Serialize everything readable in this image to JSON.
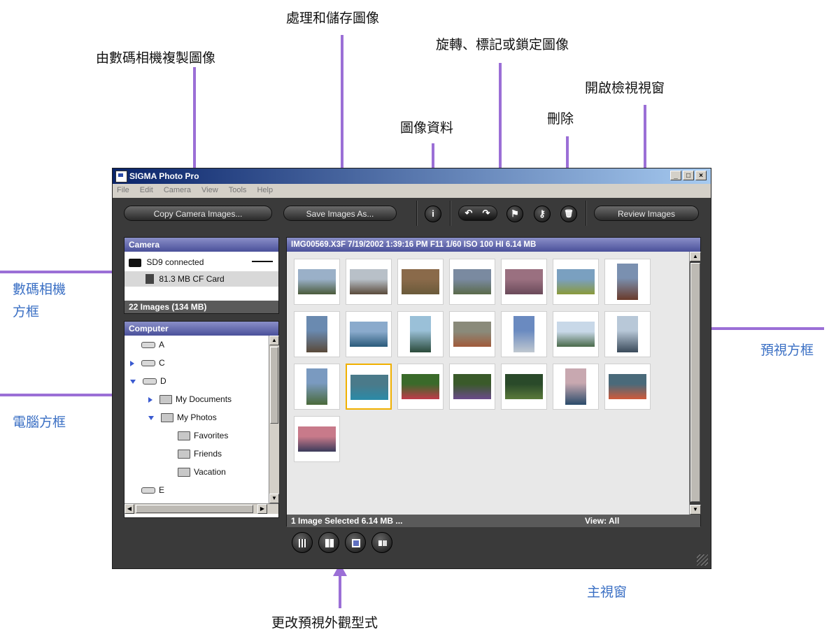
{
  "annotations": {
    "copy_from_camera": "由數碼相機複製圖像",
    "process_save": "處理和儲存圖像",
    "rotate_mark_lock": "旋轉、標記或鎖定圖像",
    "open_review": "開啟檢視視窗",
    "delete": "刪除",
    "image_info": "圖像資料",
    "camera_pane_line1": "數碼相機",
    "camera_pane_line2": "方框",
    "computer_pane": "電腦方框",
    "preview_pane": "預視方框",
    "main_window": "主視窗",
    "change_preview_style": "更改預視外觀型式"
  },
  "window": {
    "title": "SIGMA Photo Pro",
    "controls": [
      "_",
      "□",
      "×"
    ]
  },
  "menu": [
    "File",
    "Edit",
    "Camera",
    "View",
    "Tools",
    "Help"
  ],
  "toolbar": {
    "copy_label": "Copy Camera Images...",
    "save_label": "Save Images As...",
    "review_label": "Review Images",
    "info_glyph": "i",
    "rotate_left_glyph": "↶",
    "rotate_right_glyph": "↷",
    "flag_glyph": "⚑",
    "key_glyph": "⚷",
    "trash_glyph": "🗑"
  },
  "camera_panel": {
    "header": "Camera",
    "device": "SD9 connected",
    "card": "81.3 MB CF Card",
    "footer": "22 Images  (134 MB)"
  },
  "computer_panel": {
    "header": "Computer",
    "tree": [
      {
        "label": "A",
        "type": "drive",
        "expand": "",
        "indent": 0
      },
      {
        "label": "C",
        "type": "drive",
        "expand": "right",
        "indent": 0
      },
      {
        "label": "D",
        "type": "drive",
        "expand": "down",
        "indent": 0
      },
      {
        "label": "My Documents",
        "type": "folder",
        "expand": "right",
        "indent": 1
      },
      {
        "label": "My Photos",
        "type": "folder",
        "expand": "down",
        "indent": 1
      },
      {
        "label": "Favorites",
        "type": "folder",
        "expand": "",
        "indent": 2
      },
      {
        "label": "Friends",
        "type": "folder",
        "expand": "",
        "indent": 2
      },
      {
        "label": "Vacation",
        "type": "folder",
        "expand": "",
        "indent": 2
      },
      {
        "label": "E",
        "type": "drive",
        "expand": "",
        "indent": 0
      }
    ]
  },
  "preview_panel": {
    "info_bar": "IMG00569.X3F  7/19/2002  1:39:16 PM  F11  1/60  ISO 100  HI  6.14 MB",
    "status_left": "1 Image Selected  6.14 MB ...",
    "status_right": "View: All",
    "thumbnails": [
      {
        "orient": "landscape",
        "colors": [
          "#9ab0c8",
          "#4a5a3a"
        ],
        "selected": false
      },
      {
        "orient": "landscape",
        "colors": [
          "#b8c0c8",
          "#5a4a3a"
        ],
        "selected": false
      },
      {
        "orient": "landscape",
        "colors": [
          "#8a6a4a",
          "#6a5a3a"
        ],
        "selected": false
      },
      {
        "orient": "landscape",
        "colors": [
          "#7a8aa0",
          "#5a6a4a"
        ],
        "selected": false
      },
      {
        "orient": "landscape",
        "colors": [
          "#9a7080",
          "#6a4a5a"
        ],
        "selected": false
      },
      {
        "orient": "landscape",
        "colors": [
          "#7aa0c0",
          "#8a9a3a"
        ],
        "selected": false
      },
      {
        "orient": "portrait",
        "colors": [
          "#7a90b0",
          "#6a3a2a"
        ],
        "selected": false
      },
      {
        "orient": "portrait",
        "colors": [
          "#6a8ab0",
          "#5a4a3a"
        ],
        "selected": false
      },
      {
        "orient": "landscape",
        "colors": [
          "#8aaacc",
          "#2a5a7a"
        ],
        "selected": false
      },
      {
        "orient": "portrait",
        "colors": [
          "#9ac0d8",
          "#2a4a3a"
        ],
        "selected": false
      },
      {
        "orient": "landscape",
        "colors": [
          "#8a8a7a",
          "#a05a3a"
        ],
        "selected": false
      },
      {
        "orient": "portrait",
        "colors": [
          "#6a8ac0",
          "#c0c8d0"
        ],
        "selected": false
      },
      {
        "orient": "landscape",
        "colors": [
          "#c8d8e8",
          "#4a6a4a"
        ],
        "selected": false
      },
      {
        "orient": "portrait",
        "colors": [
          "#b8c8d8",
          "#3a4a5a"
        ],
        "selected": false
      },
      {
        "orient": "portrait",
        "colors": [
          "#7a9ac0",
          "#4a6a3a"
        ],
        "selected": false
      },
      {
        "orient": "landscape",
        "colors": [
          "#4a7a8a",
          "#2a8aa8"
        ],
        "selected": true
      },
      {
        "orient": "landscape",
        "colors": [
          "#3a6a2a",
          "#c03a4a"
        ],
        "selected": false
      },
      {
        "orient": "landscape",
        "colors": [
          "#3a5a2a",
          "#6a4a8a"
        ],
        "selected": false
      },
      {
        "orient": "landscape",
        "colors": [
          "#2a4a2a",
          "#5a7a3a"
        ],
        "selected": false
      },
      {
        "orient": "portrait",
        "colors": [
          "#c8a8b0",
          "#2a4a6a"
        ],
        "selected": false
      },
      {
        "orient": "landscape",
        "colors": [
          "#4a6a7a",
          "#d05a3a"
        ],
        "selected": false
      },
      {
        "orient": "landscape",
        "colors": [
          "#c87a8a",
          "#3a3a5a"
        ],
        "selected": false
      }
    ]
  },
  "view_buttons": [
    "grid-small-view",
    "grid-large-view",
    "single-view",
    "detail-view"
  ]
}
